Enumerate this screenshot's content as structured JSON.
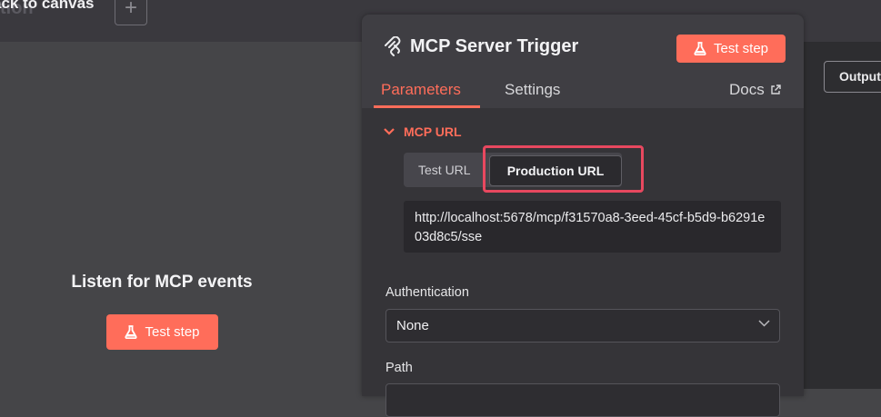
{
  "canvas": {
    "back_label": "ack to canvas",
    "ghost_text": "tion"
  },
  "left": {
    "title": "Listen for MCP events",
    "test_button": "Test step"
  },
  "panel": {
    "title": "MCP Server Trigger",
    "test_button": "Test step",
    "tabs": [
      {
        "label": "Parameters",
        "active": true
      },
      {
        "label": "Settings",
        "active": false
      }
    ],
    "docs_label": "Docs",
    "section_label": "MCP URL",
    "url_toggle": {
      "options": [
        "Test URL",
        "Production URL"
      ],
      "selected": "Production URL"
    },
    "url_value": "http://localhost:5678/mcp/f31570a8-3eed-45cf-b5d9-b6291e03d8c5/sse",
    "authentication": {
      "label": "Authentication",
      "value": "None"
    },
    "path": {
      "label": "Path",
      "value": ""
    }
  },
  "output": {
    "label": "Output"
  },
  "colors": {
    "accent": "#ff6d5a",
    "highlight": "#e8485f",
    "panel": "#353438"
  },
  "icons": [
    "plus-icon",
    "flask-icon",
    "mcp-logo-icon",
    "external-link-icon",
    "chevron-down-icon"
  ]
}
